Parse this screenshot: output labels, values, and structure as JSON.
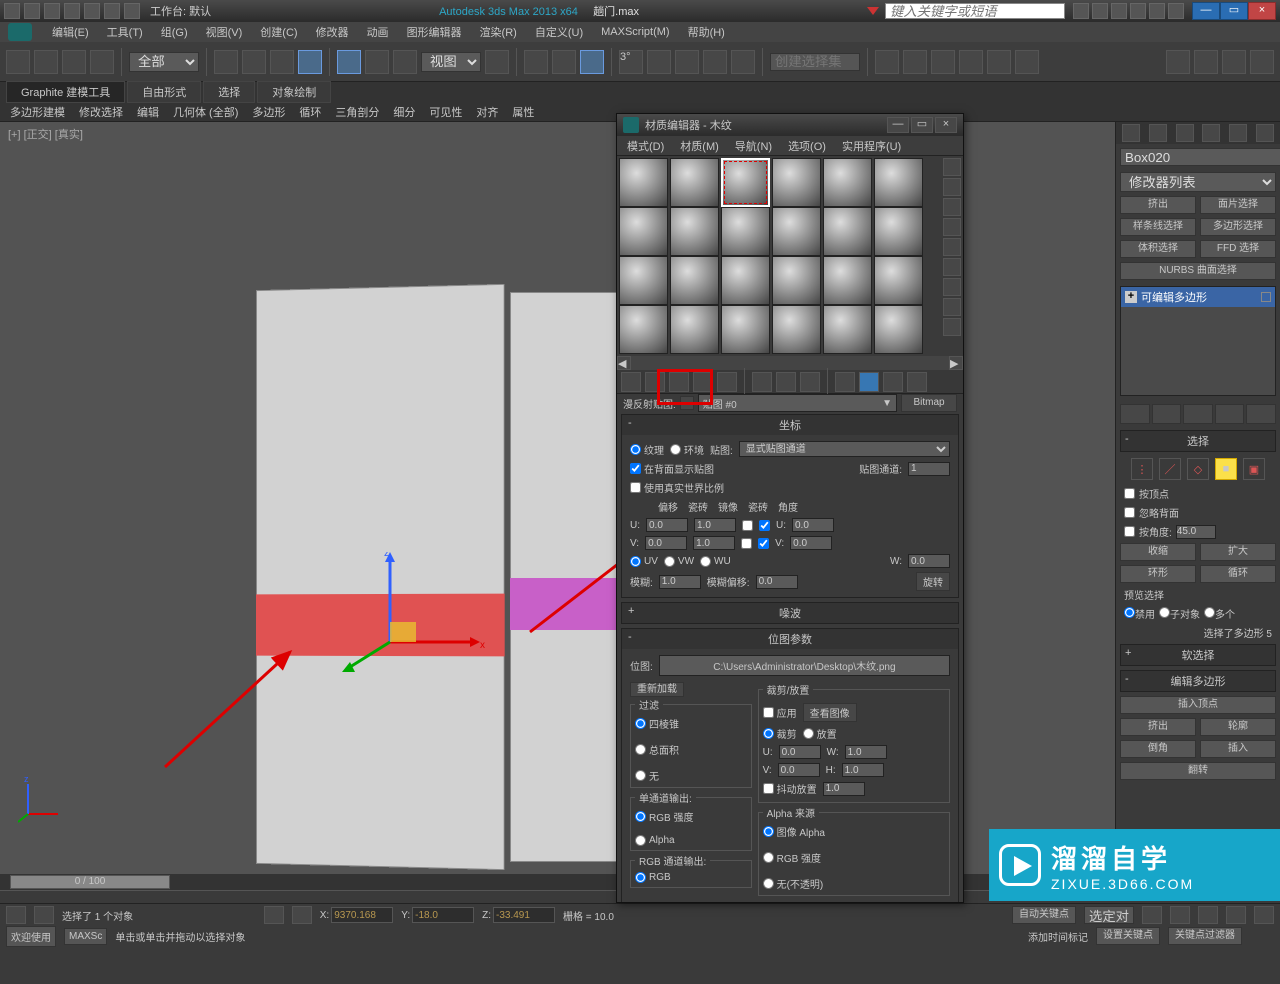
{
  "titlebar": {
    "workspace": "工作台: 默认",
    "app_title": "Autodesk 3ds Max  2013 x64",
    "file_name": "趟门.max",
    "search_placeholder": "键入关键字或短语",
    "min": "—",
    "max": "▭",
    "close": "×"
  },
  "menubar": [
    "编辑(E)",
    "工具(T)",
    "组(G)",
    "视图(V)",
    "创建(C)",
    "修改器",
    "动画",
    "图形编辑器",
    "渲染(R)",
    "自定义(U)",
    "MAXScript(M)",
    "帮助(H)"
  ],
  "toolbar": {
    "selfilter": "全部",
    "viewmode": "视图",
    "namedset_placeholder": "创建选择集"
  },
  "ribbon_tabs": [
    "Graphite 建模工具",
    "自由形式",
    "选择",
    "对象绘制"
  ],
  "ribbon_sub": [
    "多边形建模",
    "修改选择",
    "编辑",
    "几何体 (全部)",
    "多边形",
    "循环",
    "三角剖分",
    "细分",
    "可见性",
    "对齐",
    "属性"
  ],
  "viewport": {
    "label": "[+] [正交] [真实]"
  },
  "rpanel": {
    "objname": "Box020",
    "modlist": "修改器列表",
    "btns": {
      "extrude": "挤出",
      "face": "面片选择",
      "spline": "样条线选择",
      "poly": "多边形选择",
      "lattice": "体积选择",
      "ffd": "FFD 选择"
    },
    "nurbs_sel": "NURBS 曲面选择",
    "stack_item": "可编辑多边形",
    "sel_hdr": "选择",
    "by_vertex": "按顶点",
    "ignore_bf": "忽略背面",
    "by_angle": "按角度:",
    "angle_val": "45.0",
    "shrink": "收缩",
    "grow": "扩大",
    "ring": "环形",
    "loop": "循环",
    "preview": "预览选择",
    "off": "禁用",
    "subobj": "子对象",
    "multi": "多个",
    "sel_status": "选择了多边形 5",
    "soft_hdr": "软选择",
    "editpoly_hdr": "编辑多边形",
    "insvert": "插入顶点",
    "extrude2": "挤出",
    "outline": "轮廓",
    "bevel": "倒角",
    "inset": "插入",
    "flip": "翻转"
  },
  "mateditor": {
    "title": "材质编辑器 - 木纹",
    "menus": [
      "模式(D)",
      "材质(M)",
      "导航(N)",
      "选项(O)",
      "实用程序(U)"
    ],
    "mapname_label": "漫反射贴图:",
    "mapname": "贴图 #0",
    "maptype": "Bitmap",
    "coord_hdr": "坐标",
    "texture": "纹理",
    "env": "环境",
    "maplbl": "贴图:",
    "mapchan": "显式贴图通道",
    "showbg": "在背面显示贴图",
    "mapch_lbl": "贴图通道:",
    "mapch_val": "1",
    "realworld": "使用真实世界比例",
    "offset": "偏移",
    "tiling": "瓷砖",
    "mirror": "镜像",
    "tile": "瓷砖",
    "angle": "角度",
    "u": "U:",
    "v": "V:",
    "w": "W:",
    "u_off": "0.0",
    "u_til": "1.0",
    "u_ang": "0.0",
    "v_off": "0.0",
    "v_til": "1.0",
    "v_ang": "0.0",
    "w_ang": "0.0",
    "uv": "UV",
    "vw": "VW",
    "wu": "WU",
    "blur": "模糊:",
    "blur_val": "1.0",
    "bluroff": "模糊偏移:",
    "bluroff_val": "0.0",
    "rotate": "旋转",
    "noise_hdr": "噪波",
    "bitmap_hdr": "位图参数",
    "bitmap_lbl": "位图:",
    "bitmap_path": "C:\\Users\\Administrator\\Desktop\\木纹.png",
    "reload": "重新加载",
    "crop_hdr": "裁剪/放置",
    "apply": "应用",
    "viewimg": "查看图像",
    "crop": "裁剪",
    "place": "放置",
    "cu": "0.0",
    "cv": "0.0",
    "cw": "1.0",
    "ch": "1.0",
    "jitter": "抖动放置",
    "jval": "1.0",
    "filter_hdr": "过滤",
    "pyramidal": "四棱锥",
    "sat": "总面积",
    "none": "无",
    "mono_hdr": "单通道输出:",
    "rgbint": "RGB 强度",
    "alpha": "Alpha",
    "rgbout_hdr": "RGB 通道输出:",
    "rgb": "RGB",
    "alphasrc_hdr": "Alpha 来源",
    "imgalpha": "图像 Alpha",
    "rgbint2": "RGB 强度",
    "none2": "无(不透明)"
  },
  "timeline": {
    "pos": "0 / 100"
  },
  "status": {
    "sel_obj": "选择了 1 个对象",
    "x": "X:",
    "xv": "9370.168",
    "y": "Y:",
    "yv": "-18.0",
    "z": "Z:",
    "zv": "-33.491",
    "grid": "栅格 = 10.0",
    "autokey": "自动关键点",
    "selset": "选定对",
    "welcome": "欢迎使用",
    "maxsc": "MAXSc",
    "hint": "单击或单击并拖动以选择对象",
    "addtime": "添加时间标记",
    "setkey": "设置关键点",
    "keyfilter": "关键点过滤器"
  },
  "watermark": {
    "big": "溜溜自学",
    "url": "ZIXUE.3D66.COM"
  }
}
